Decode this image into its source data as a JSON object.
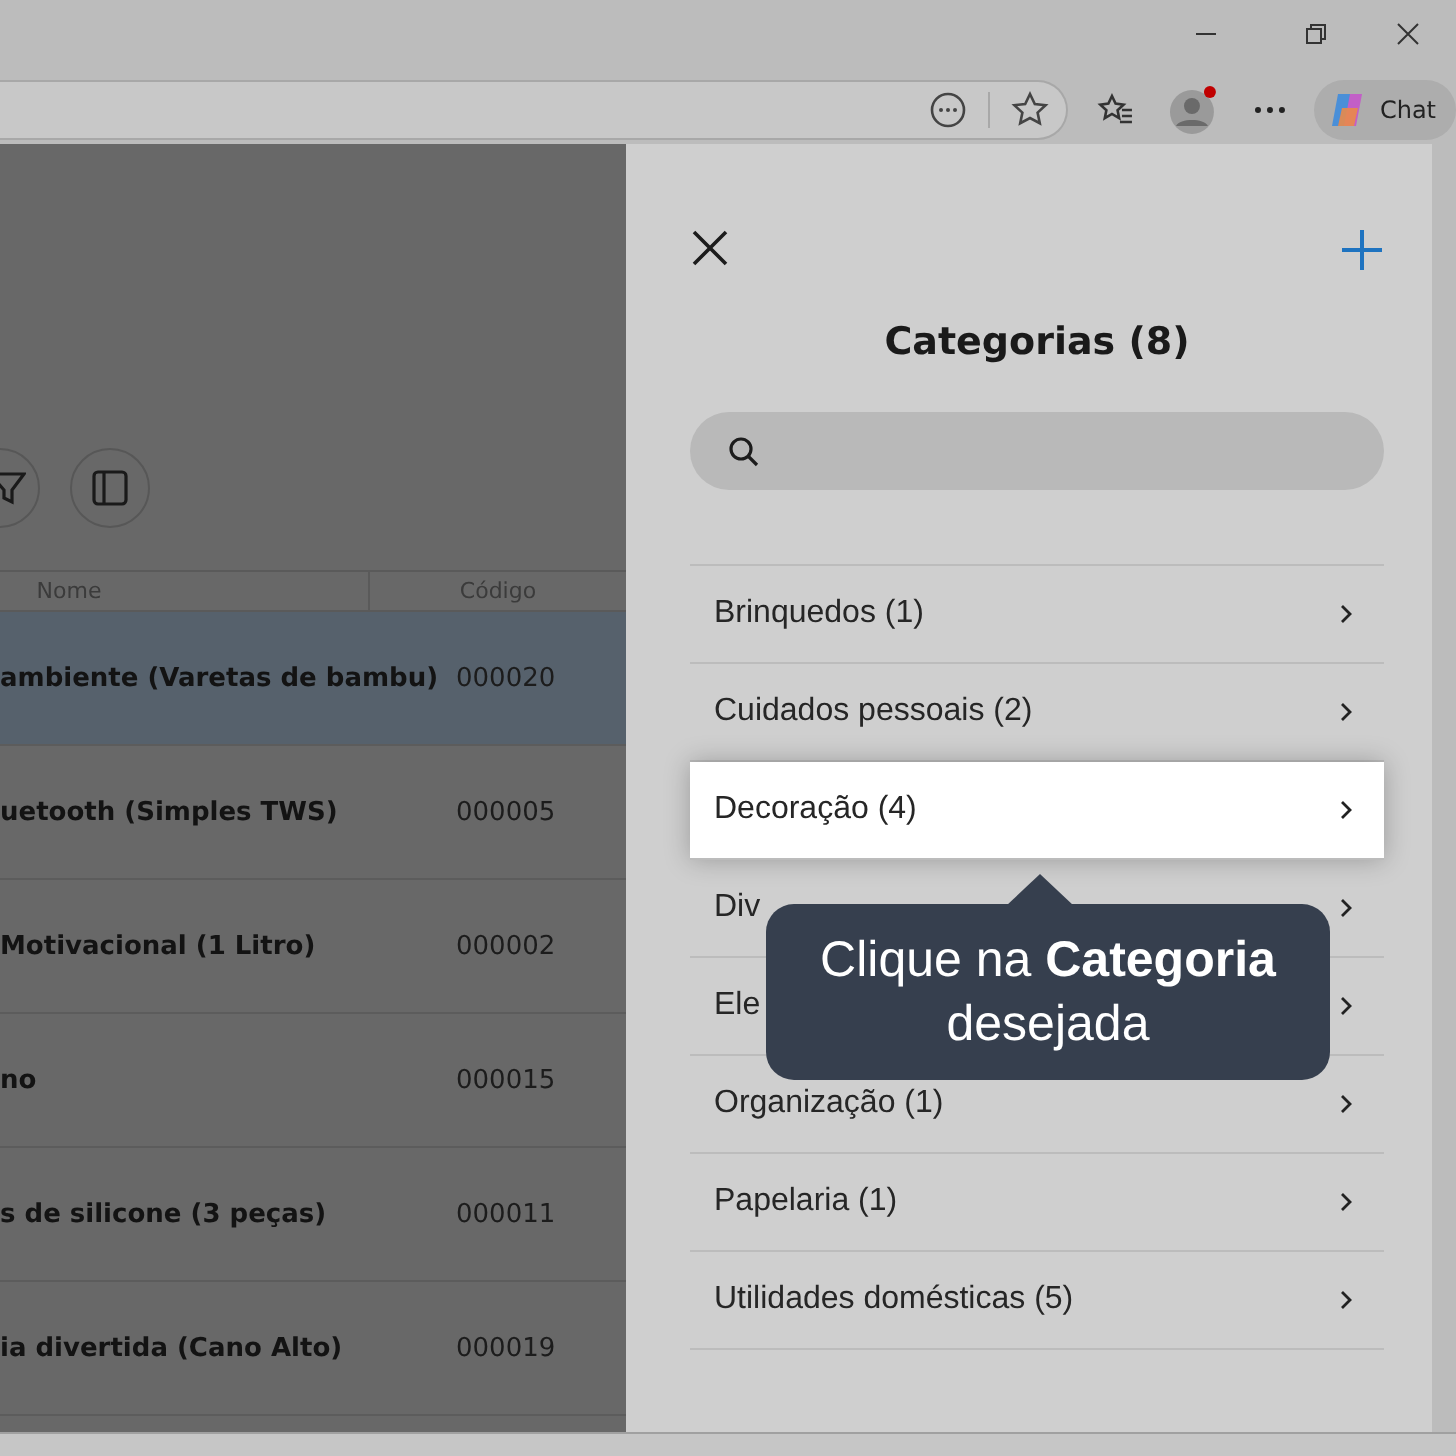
{
  "browser": {
    "chat_label": "Chat",
    "profile_notification": true
  },
  "toolbar": {
    "buttons": [
      {
        "kind": "filter"
      },
      {
        "kind": "panel"
      }
    ]
  },
  "table": {
    "columns": [
      "Nome",
      "Código"
    ],
    "rows": [
      {
        "name": "ambiente (Varetas de bambu)",
        "code": "000020",
        "selected": true
      },
      {
        "name": "uetooth (Simples TWS)",
        "code": "000005",
        "selected": false
      },
      {
        "name": "Motivacional (1 Litro)",
        "code": "000002",
        "selected": false
      },
      {
        "name": "no",
        "code": "000015",
        "selected": false
      },
      {
        "name": "s de silicone (3 peças)",
        "code": "000011",
        "selected": false
      },
      {
        "name": "ia divertida (Cano Alto)",
        "code": "000019",
        "selected": false
      }
    ]
  },
  "panel": {
    "title": "Categorias (8)",
    "categories": [
      {
        "label": "Brinquedos (1)",
        "selected": false
      },
      {
        "label": "Cuidados pessoais (2)",
        "selected": false
      },
      {
        "label": "Decoração (4)",
        "selected": true
      },
      {
        "label": "Div",
        "selected": false
      },
      {
        "label": "Ele",
        "selected": false
      },
      {
        "label": "Organização (1)",
        "selected": false
      },
      {
        "label": "Papelaria (1)",
        "selected": false
      },
      {
        "label": "Utilidades domésticas (5)",
        "selected": false
      }
    ]
  },
  "tooltip": {
    "text": "Clique na **Categoria** desejada"
  }
}
